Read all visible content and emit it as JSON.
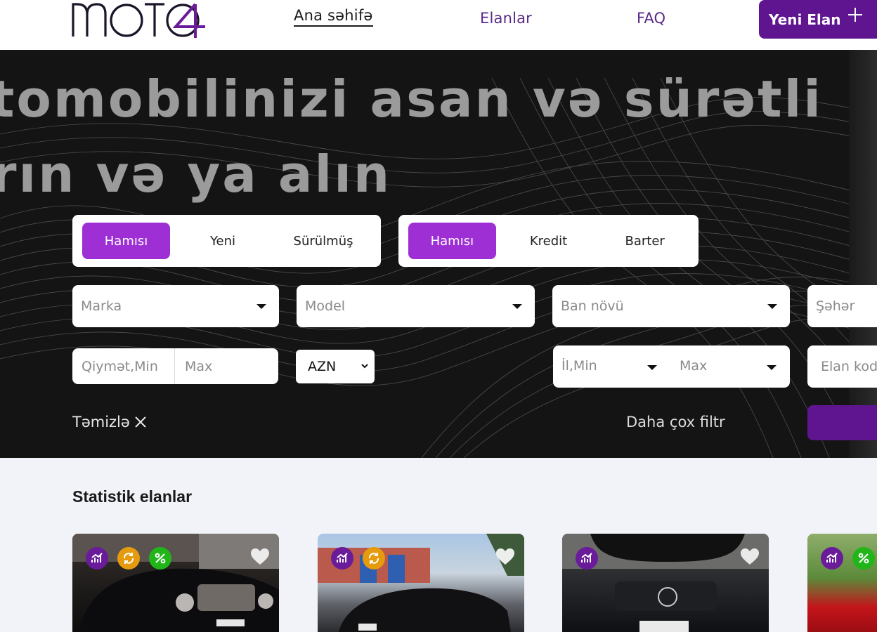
{
  "header": {
    "logo_text": "MOTO4",
    "nav": {
      "home": "Ana səhifə",
      "ads": "Elanlar",
      "faq": "FAQ"
    },
    "new_ad_label": "Yeni Elan"
  },
  "hero": {
    "headline_line1": "tomobilinizi asan və sürətli",
    "headline_line2": "rın və ya alın"
  },
  "filters": {
    "condition_tabs": [
      "Hamısı",
      "Yeni",
      "Sürülmüş"
    ],
    "payment_tabs": [
      "Hamısı",
      "Kredit",
      "Barter"
    ],
    "marka_placeholder": "Marka",
    "model_placeholder": "Model",
    "ban_placeholder": "Ban növü",
    "city_placeholder": "Şəhər",
    "price_min_placeholder": "Qiymət,Min",
    "price_max_placeholder": "Max",
    "currency": "AZN",
    "year_min_placeholder": "İl,Min",
    "year_max_placeholder": "Max",
    "code_placeholder": "Elan kodu",
    "clear_label": "Təmizlə",
    "more_filter_label": "Daha çox filtr"
  },
  "stats": {
    "title": "Statistik elanlar"
  },
  "colors": {
    "brand": "#5f1590",
    "accent": "#9d2fd4",
    "hero_bg": "#151415",
    "page_bg": "#f1f3f8"
  }
}
